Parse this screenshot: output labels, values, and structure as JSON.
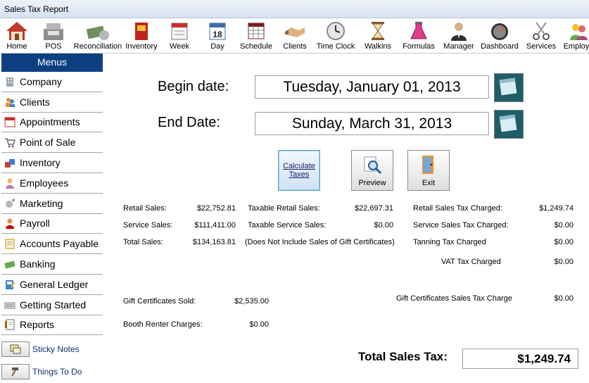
{
  "window": {
    "title": "Sales Tax Report"
  },
  "toolbar": [
    {
      "label": "Home",
      "icon": "house-icon"
    },
    {
      "label": "POS",
      "icon": "cash-register-icon"
    },
    {
      "label": "Reconciliation",
      "icon": "money-stack-icon"
    },
    {
      "label": "Inventory",
      "icon": "inventory-box-icon"
    },
    {
      "label": "Week",
      "icon": "week-calendar-icon"
    },
    {
      "label": "Day",
      "icon": "day-calendar-icon"
    },
    {
      "label": "Schedule",
      "icon": "schedule-grid-icon"
    },
    {
      "label": "Clients",
      "icon": "handshake-icon"
    },
    {
      "label": "Time Clock",
      "icon": "clock-icon"
    },
    {
      "label": "Walkins",
      "icon": "hourglass-icon"
    },
    {
      "label": "Formulas",
      "icon": "flask-icon"
    },
    {
      "label": "Manager",
      "icon": "manager-person-icon"
    },
    {
      "label": "Dashboard",
      "icon": "gauge-icon"
    },
    {
      "label": "Services",
      "icon": "scissors-icon"
    },
    {
      "label": "Employe",
      "icon": "employees-group-icon"
    }
  ],
  "sidebar": {
    "header": "Menus",
    "items": [
      {
        "label": "Company",
        "icon": "building-icon"
      },
      {
        "label": "Clients",
        "icon": "people-icon"
      },
      {
        "label": "Appointments",
        "icon": "appointment-calendar-icon"
      },
      {
        "label": "Point of Sale",
        "icon": "shopping-cart-icon"
      },
      {
        "label": "Inventory",
        "icon": "boxes-icon"
      },
      {
        "label": "Employees",
        "icon": "employee-icon"
      },
      {
        "label": "Marketing",
        "icon": "marketing-icon"
      },
      {
        "label": "Payroll",
        "icon": "payroll-icon"
      },
      {
        "label": "Accounts Payable",
        "icon": "bills-icon"
      },
      {
        "label": "Banking",
        "icon": "banking-money-icon"
      },
      {
        "label": "General Ledger",
        "icon": "ledger-book-icon"
      },
      {
        "label": "Getting Started",
        "icon": "keyboard-icon"
      },
      {
        "label": "Reports",
        "icon": "report-icon"
      }
    ],
    "extras": [
      {
        "label": "Sticky Notes",
        "icon": "sticky-note-icon"
      },
      {
        "label": "Things To Do",
        "icon": "hammer-icon"
      }
    ]
  },
  "dates": {
    "begin_label": "Begin date:",
    "begin_value": "Tuesday, January 01, 2013",
    "end_label": "End Date:",
    "end_value": "Sunday, March 31, 2013"
  },
  "actions": {
    "calculate_line1": "Calculate",
    "calculate_line2": "Taxes",
    "preview": "Preview",
    "exit": "Exit"
  },
  "summary": {
    "retail_sales_label": "Retail Sales:",
    "retail_sales_value": "$22,752.81",
    "service_sales_label": "Service Sales:",
    "service_sales_value": "$111,411.00",
    "total_sales_label": "Total Sales:",
    "total_sales_value": "$134,163.81",
    "taxable_retail_label": "Taxable Retail Sales:",
    "taxable_retail_value": "$22,697.31",
    "taxable_service_label": "Taxable Service Sales:",
    "taxable_service_value": "$0.00",
    "gift_note": "(Does Not Include Sales of Gift Certificates)",
    "retail_tax_label": "Retail Sales Tax Charged:",
    "retail_tax_value": "$1,249.74",
    "service_tax_label": "Service Sales Tax Charged:",
    "service_tax_value": "$0.00",
    "tanning_tax_label": "Tanning Tax Charged",
    "tanning_tax_value": "$0.00",
    "vat_tax_label": "VAT Tax Charged",
    "vat_tax_value": "$0.00",
    "gift_sold_label": "Gift Certificates Sold:",
    "gift_sold_value": "$2,535.00",
    "gift_tax_label": "Gift Certificates Sales Tax Charge",
    "gift_tax_value": "$0.00",
    "booth_label": "Booth Renter Charges:",
    "booth_value": "$0.00",
    "total_tax_label": "Total Sales Tax:",
    "total_tax_value": "$1,249.74"
  }
}
